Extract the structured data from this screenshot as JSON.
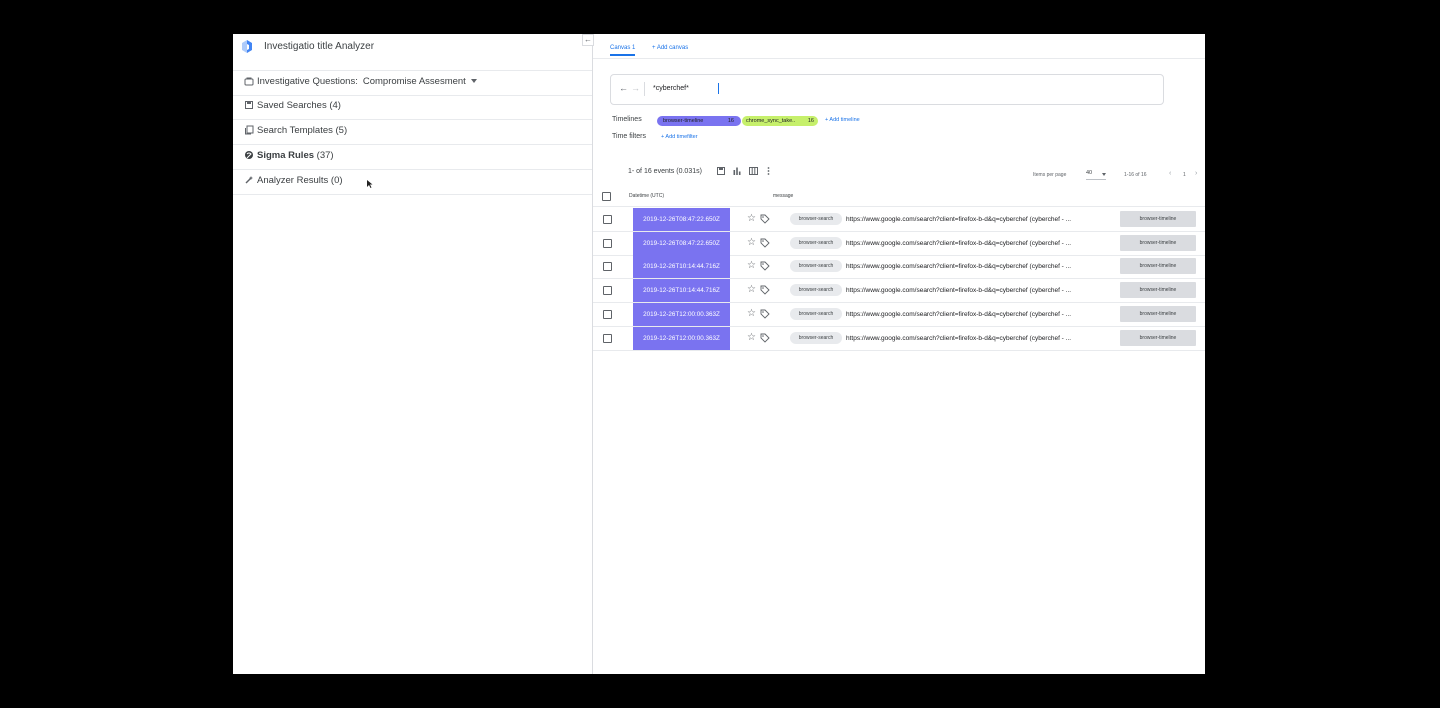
{
  "app": {
    "title": "Investigatio title Analyzer"
  },
  "collapse_icon": "←",
  "sidebar": {
    "investigative_questions": {
      "label": "Investigative Questions:",
      "value": "Compromise Assesment",
      "icon": "investigate-icon"
    },
    "items": [
      {
        "label": "Saved Searches (4)",
        "icon": "saved-search-icon",
        "bold": false
      },
      {
        "label": "Search Templates (5)",
        "icon": "template-icon",
        "bold": false
      },
      {
        "label_bold": "Sigma Rules",
        "label_rest": " (37)",
        "icon": "sigma-icon",
        "bold": true
      },
      {
        "label": "Analyzer Results (0)",
        "icon": "analyzer-icon",
        "bold": false
      }
    ]
  },
  "tabs": {
    "active": "Canvas 1",
    "add": "+ Add canvas"
  },
  "search": {
    "query": "*cyberchef*",
    "back": "←",
    "forward": "→"
  },
  "timelines": {
    "label": "Timelines",
    "chips": [
      {
        "name": "browser-timeline",
        "count": "16",
        "color": "#7a73f0"
      },
      {
        "name": "chrome_sync_take..",
        "count": "16",
        "color": "#c6f06b"
      }
    ],
    "add": "+ Add timeline"
  },
  "time_filters": {
    "label": "Time filters",
    "add": "+ Add timefilter"
  },
  "results": {
    "count": "1- of 16 events (0.031s)",
    "items_per_page_label": "Items per page",
    "items_per_page": "40",
    "range": "1-16 of 16",
    "page": "1",
    "prev": "‹",
    "next": "›"
  },
  "table": {
    "headers": {
      "datetime": "Datetime (UTC)",
      "message": "message"
    },
    "rows": [
      {
        "datetime": "2019-12-26T08:47:22.650Z",
        "tag": "browser-search",
        "message": "https://www.google.com/search?client=firefox-b-d&q=cyberchef (cyberchef - ...",
        "timeline": "browser-timeline"
      },
      {
        "datetime": "2019-12-26T08:47:22.650Z",
        "tag": "browser-search",
        "message": "https://www.google.com/search?client=firefox-b-d&q=cyberchef (cyberchef - ...",
        "timeline": "browser-timeline"
      },
      {
        "datetime": "2019-12-26T10:14:44.716Z",
        "tag": "browser-search",
        "message": "https://www.google.com/search?client=firefox-b-d&q=cyberchef (cyberchef - ...",
        "timeline": "browser-timeline"
      },
      {
        "datetime": "2019-12-26T10:14:44.716Z",
        "tag": "browser-search",
        "message": "https://www.google.com/search?client=firefox-b-d&q=cyberchef (cyberchef - ...",
        "timeline": "browser-timeline"
      },
      {
        "datetime": "2019-12-26T12:00:00.363Z",
        "tag": "browser-search",
        "message": "https://www.google.com/search?client=firefox-b-d&q=cyberchef (cyberchef - ...",
        "timeline": "browser-timeline"
      },
      {
        "datetime": "2019-12-26T12:00:00.363Z",
        "tag": "browser-search",
        "message": "https://www.google.com/search?client=firefox-b-d&q=cyberchef (cyberchef - ...",
        "timeline": "browser-timeline"
      }
    ]
  }
}
